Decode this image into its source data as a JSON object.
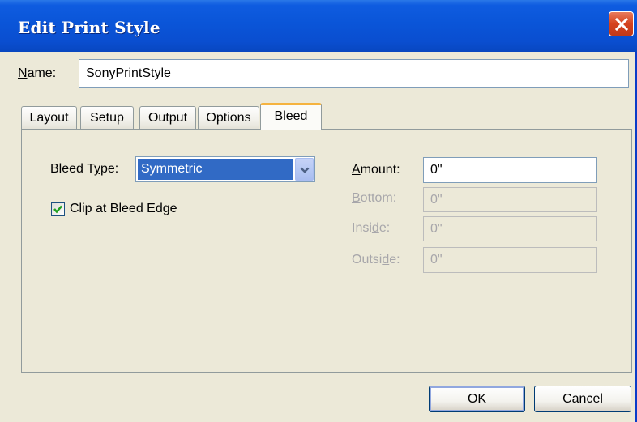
{
  "window": {
    "title": "Edit Print Style"
  },
  "name_field": {
    "label_accel": "N",
    "label_rest": "ame:",
    "value": "SonyPrintStyle"
  },
  "tabs": [
    {
      "label": "Layout",
      "active": false
    },
    {
      "label": "Setup",
      "active": false
    },
    {
      "label": "Output",
      "active": false
    },
    {
      "label": "Options",
      "active": false
    },
    {
      "label": "Bleed",
      "active": true
    }
  ],
  "bleed": {
    "type_label_pre": "Bleed T",
    "type_label_accel": "y",
    "type_label_post": "pe:",
    "type_value": "Symmetric",
    "clip_label": "Clip at Bleed Edge",
    "clip_checked": true,
    "amount_label_accel": "A",
    "amount_label_rest": "mount:",
    "amount_value": "0\"",
    "bottom_label_accel": "B",
    "bottom_label_rest": "ottom:",
    "bottom_value": "0\"",
    "inside_label_pre": "Insi",
    "inside_label_accel": "d",
    "inside_label_post": "e:",
    "inside_value": "0\"",
    "outside_label_pre": "Outsi",
    "outside_label_accel": "d",
    "outside_label_post": "e:",
    "outside_value": "0\""
  },
  "buttons": {
    "ok": "OK",
    "cancel": "Cancel"
  },
  "colors": {
    "titlebar": "#0a55d8",
    "close": "#d5421e",
    "selection": "#316ac5",
    "active_tab_accent": "#f5b33f"
  }
}
